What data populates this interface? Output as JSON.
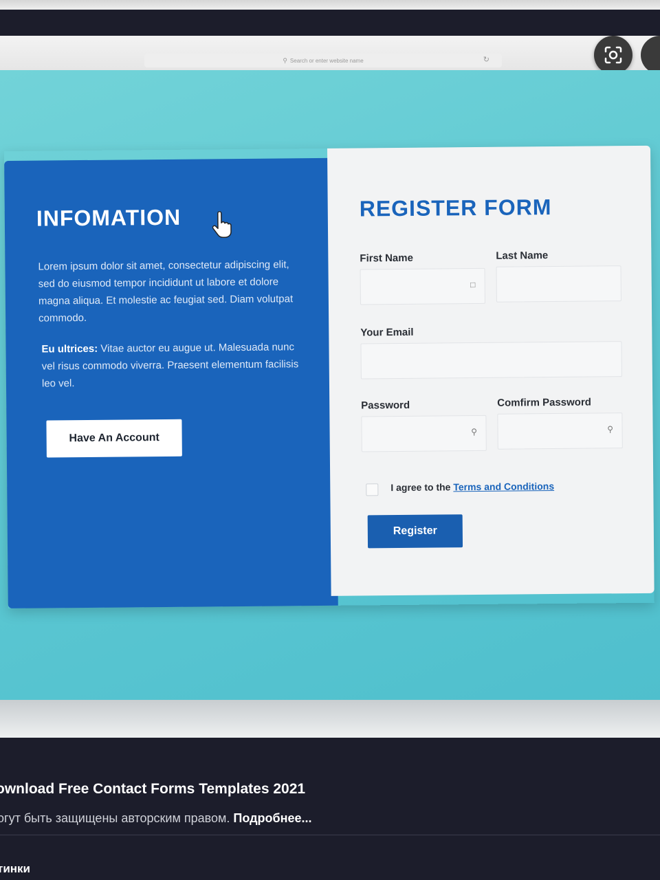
{
  "browser": {
    "address_placeholder": "Search or enter website name"
  },
  "info": {
    "title": "INFOMATION",
    "paragraph1": "Lorem ipsum dolor sit amet, consectetur adipiscing elit, sed do eiusmod tempor incididunt ut labore et dolore magna aliqua. Et molestie ac feugiat sed. Diam volutpat commodo.",
    "paragraph2_bold": "Eu ultrices:",
    "paragraph2_rest": " Vitae auctor eu augue ut. Malesuada nunc vel risus commodo viverra. Praesent elementum facilisis leo vel.",
    "have_account_label": "Have An Account"
  },
  "form": {
    "title": "REGISTER FORM",
    "first_name_label": "First Name",
    "last_name_label": "Last Name",
    "email_label": "Your Email",
    "password_label": "Password",
    "confirm_password_label": "Comfirm Password",
    "agree_text": "I agree to the ",
    "terms_link": "Terms and Conditions",
    "register_label": "Register"
  },
  "search_result": {
    "title": "ownload Free Contact Forms Templates 2021",
    "subtitle": "огут быть защищены авторским правом. ",
    "more_link": "Подробнее...",
    "section_label": "тинки"
  },
  "colors": {
    "page_bg": "#5bc7d2",
    "info_panel": "#1a64bb",
    "form_panel": "#f2f3f4",
    "accent": "#1a64bb"
  }
}
